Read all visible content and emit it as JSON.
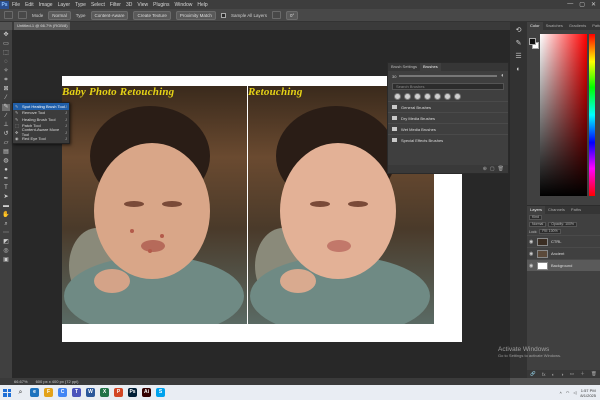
{
  "menu": {
    "logo": "Ps",
    "items": [
      "File",
      "Edit",
      "Image",
      "Layer",
      "Type",
      "Select",
      "Filter",
      "3D",
      "View",
      "Plugins",
      "Window",
      "Help"
    ],
    "controls": [
      "—",
      "▢",
      "✕"
    ]
  },
  "options": {
    "mode_label": "Mode",
    "mode_value": "Normal",
    "type_label": "Type",
    "type_buttons": [
      "Content-Aware",
      "Create Texture",
      "Proximity Match"
    ],
    "sample_all_label": "Sample All Layers",
    "angle_label": "0°"
  },
  "document": {
    "tab_title": "Untitled-1 @ 66.7% (RGB/8) *",
    "title_left": "Baby Photo Retouching",
    "title_right": "Retouching"
  },
  "flyout": {
    "items": [
      {
        "label": "Spot Healing Brush Tool",
        "key": "J",
        "icon": "✎"
      },
      {
        "label": "Remove Tool",
        "key": "J",
        "icon": "✎"
      },
      {
        "label": "Healing Brush Tool",
        "key": "J",
        "icon": "✎"
      },
      {
        "label": "Patch Tool",
        "key": "J",
        "icon": "⬚"
      },
      {
        "label": "Content-Aware Move Tool",
        "key": "J",
        "icon": "✥"
      },
      {
        "label": "Red Eye Tool",
        "key": "J",
        "icon": "◉"
      }
    ]
  },
  "brushes": {
    "tabs": [
      "Brush Settings",
      "Brushes"
    ],
    "size_value": "30",
    "search_placeholder": "Search Brushes",
    "folders": [
      "General Brushes",
      "Dry Media Brushes",
      "Wet Media Brushes",
      "Special Effects Brushes"
    ],
    "bottom_icons": [
      "⊕",
      "▢",
      "🗑"
    ]
  },
  "color_panel": {
    "tabs": [
      "Color",
      "Swatches",
      "Gradients",
      "Patterns"
    ]
  },
  "layers": {
    "tabs": [
      "Layers",
      "Channels",
      "Paths"
    ],
    "kind_label": "Kind",
    "blend_mode": "Normal",
    "opacity": "Opacity: 100%",
    "lock_label": "Lock:",
    "fill": "Fill: 100%",
    "items": [
      {
        "name": "CTRL",
        "selected": false,
        "thumb": "#3a2d22"
      },
      {
        "name": "Ancient",
        "selected": false,
        "thumb": "#5c4a3a"
      },
      {
        "name": "Background",
        "selected": true,
        "thumb": "#ffffff"
      }
    ],
    "bottom_icons": [
      "🔗",
      "fx",
      "◐",
      "◑",
      "▭",
      "＋",
      "🗑"
    ]
  },
  "status": {
    "zoom": "66.67%",
    "doc_size": "600 px x 400 px (72 ppi)"
  },
  "watermark": {
    "line1": "Activate Windows",
    "line2": "Go to Settings to activate Windows."
  },
  "taskbar": {
    "apps": [
      {
        "label": "e",
        "color": "#1e73be"
      },
      {
        "label": "F",
        "color": "#e3a21a"
      },
      {
        "label": "C",
        "color": "#4285f4"
      },
      {
        "label": "T",
        "color": "#4b53bc"
      },
      {
        "label": "W",
        "color": "#2b579a"
      },
      {
        "label": "X",
        "color": "#217346"
      },
      {
        "label": "P",
        "color": "#d24726"
      },
      {
        "label": "Ps",
        "color": "#001e36"
      },
      {
        "label": "Ai",
        "color": "#330000"
      },
      {
        "label": "S",
        "color": "#00a2ed"
      }
    ],
    "time": "1:57 PM",
    "date": "8/1/2025"
  }
}
